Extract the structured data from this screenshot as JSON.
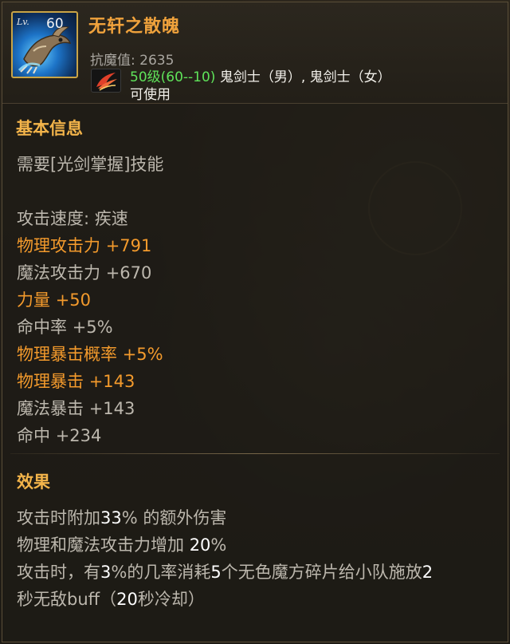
{
  "item": {
    "level_label": "Lv.",
    "level": "60",
    "name": "无轩之散魄",
    "resist_label": "抗魔值:",
    "resist_value": "2635",
    "req_level": "50级(60--10)",
    "classes": "鬼剑士（男）, 鬼剑士（女）",
    "usable": "可使用"
  },
  "basic": {
    "title": "基本信息",
    "requirement": "需要[光剑掌握]技能",
    "attack_speed": "攻击速度: 疾速",
    "stats": [
      {
        "label": "物理攻击力",
        "value": "+791",
        "highlight": true
      },
      {
        "label": "魔法攻击力",
        "value": "+670",
        "highlight": false
      },
      {
        "label": "力量",
        "value": "+50",
        "highlight": true
      },
      {
        "label": "命中率",
        "value": "+5%",
        "highlight": false
      },
      {
        "label": "物理暴击概率",
        "value": "+5%",
        "highlight": true
      },
      {
        "label": "物理暴击",
        "value": "+143",
        "highlight": true
      },
      {
        "label": "魔法暴击",
        "value": "+143",
        "highlight": false
      },
      {
        "label": "命中",
        "value": "+234",
        "highlight": false
      }
    ]
  },
  "effect": {
    "title": "效果",
    "line1_a": "攻击时附加",
    "line1_num": "33",
    "line1_b": "% 的额外伤害",
    "line2_a": "物理和魔法攻击力增加 ",
    "line2_num": "20",
    "line2_b": "%",
    "line3_a": "攻击时，有",
    "line3_n1": "3",
    "line3_b": "%的几率消耗",
    "line3_n2": "5",
    "line3_c": "个无色魔方碎片给小队施放",
    "line3_n3": "2",
    "line4_a": "秒无敌buff（",
    "line4_n": "20",
    "line4_b": "秒冷却）"
  },
  "colors": {
    "title": "#f0a23c",
    "highlight_stat": "#f39a2c",
    "normal_stat": "#bcb7ad",
    "req_level": "#5fe35a",
    "frame": "#c9a446"
  }
}
